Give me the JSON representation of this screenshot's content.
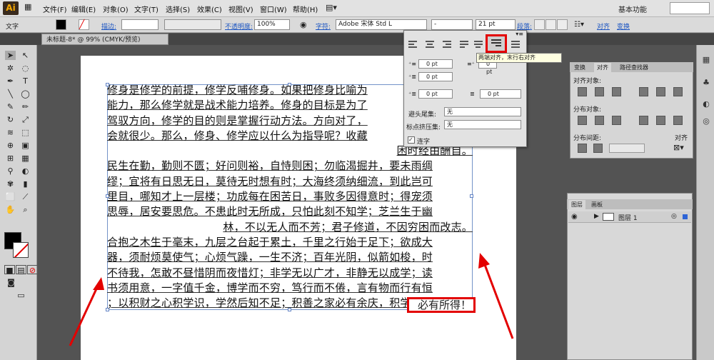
{
  "app": {
    "logo": "Ai",
    "workspace": "基本功能"
  },
  "menu": [
    "文件(F)",
    "编辑(E)",
    "对象(O)",
    "文字(T)",
    "选择(S)",
    "效果(C)",
    "视图(V)",
    "窗口(W)",
    "帮助(H)"
  ],
  "control": {
    "mode": "文字",
    "stroke_label": "描边:",
    "opacity_label": "不透明度:",
    "opacity_value": "100%",
    "char_label": "字符:",
    "font": "Adobe 宋体 Std L",
    "style": "-",
    "size": "21 pt",
    "para_label": "段落:",
    "align_label": "对齐",
    "transform_label": "变换"
  },
  "document": {
    "tab": "未标题-8* @ 99% (CMYK/预览)"
  },
  "text": {
    "lines": [
      "修身是修学的前提，修学反哺修身。如果把修身比喻为",
      "能力，那么修学就是战术能力培养。修身的目标是为了",
      "驾驭方向，修学的目的则是掌握行动方法。方向对了，",
      "会就很少。那么，修身、修学应以什么为指导呢？收藏",
      "困时经由酬自。",
      "民生在勤，勤则不匮；好问则裕，自恃则困；勿临渴掘井，要未雨绸",
      "缪；宜将有日思无日，莫待无时想有时；大海终须纳细流，到此岂可",
      "里目，哪知才上一层楼；功成每在困苦日，事败多因得意时；得宠须",
      "思辱，居安要思危。不患此时无所成，只怕此刻不知学；芝兰生于幽",
      "林，不以无人而不芳；君子修道，不因穷困而改志。",
      "合抱之木生于毫末，九层之台起于累土，千里之行始于足下；欲成大",
      "器，须耐烦莫使气；心烦气躁，一生不济；百年光阴，似箭如梭，时",
      "不待我，怎敢不昼惜阴而夜惜灯；非学无以广才，非静无以成学；读",
      "书须用意，一字值千金，博学而不穷，笃行而不倦，言有物而行有恒",
      "；以积财之心积学识，学然后知不足；积善之家必有余庆，积学之士"
    ],
    "last_line": "必有所得！"
  },
  "paragraph_panel": {
    "indent_values": [
      "0 pt",
      "0 pt",
      "0 pt",
      "0 pt",
      "0 pt"
    ],
    "kinsoku_label": "避头尾集:",
    "kinsoku_value": "无",
    "mojikumi_label": "标点挤压集:",
    "mojikumi_value": "无",
    "hyphen_label": "连字",
    "tooltip": "两端对齐，末行右对齐"
  },
  "align_panel": {
    "tabs": [
      "变换",
      "对齐",
      "路径查找器"
    ],
    "align_objects": "对齐对象:",
    "distribute_objects": "分布对象:",
    "distribute_spacing": "分布间距:",
    "align_to": "对齐"
  },
  "layers_panel": {
    "tabs": [
      "图层",
      "画板"
    ],
    "layer_name": "图层 1"
  },
  "colors": {
    "accent": "#e30000",
    "link": "#1c55c2"
  }
}
